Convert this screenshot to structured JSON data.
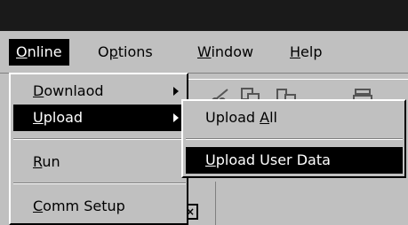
{
  "menubar": {
    "items": [
      {
        "label": "Online",
        "mnemonic": "O",
        "active": true
      },
      {
        "label": "Options",
        "mnemonic": "p"
      },
      {
        "label": "Window",
        "mnemonic": "W"
      },
      {
        "label": "Help",
        "mnemonic": "H"
      }
    ]
  },
  "online_menu": {
    "items": [
      {
        "label": "Downlaod",
        "mnemonic": "D",
        "has_submenu": true
      },
      {
        "label": "Upload",
        "mnemonic": "U",
        "has_submenu": true,
        "active": true
      },
      {
        "label": "Run",
        "mnemonic": "R"
      },
      {
        "label": "Comm Setup",
        "mnemonic": "C"
      }
    ]
  },
  "upload_submenu": {
    "items": [
      {
        "label": "Upload All",
        "mnemonic": "A"
      },
      {
        "label": "Upload User Data",
        "mnemonic": "U",
        "active": true
      }
    ]
  },
  "colors": {
    "window_bg": "#c0c0c0",
    "highlight_bg": "#000000",
    "highlight_text": "#ffffff",
    "titlebar": "#1a1a1a"
  }
}
